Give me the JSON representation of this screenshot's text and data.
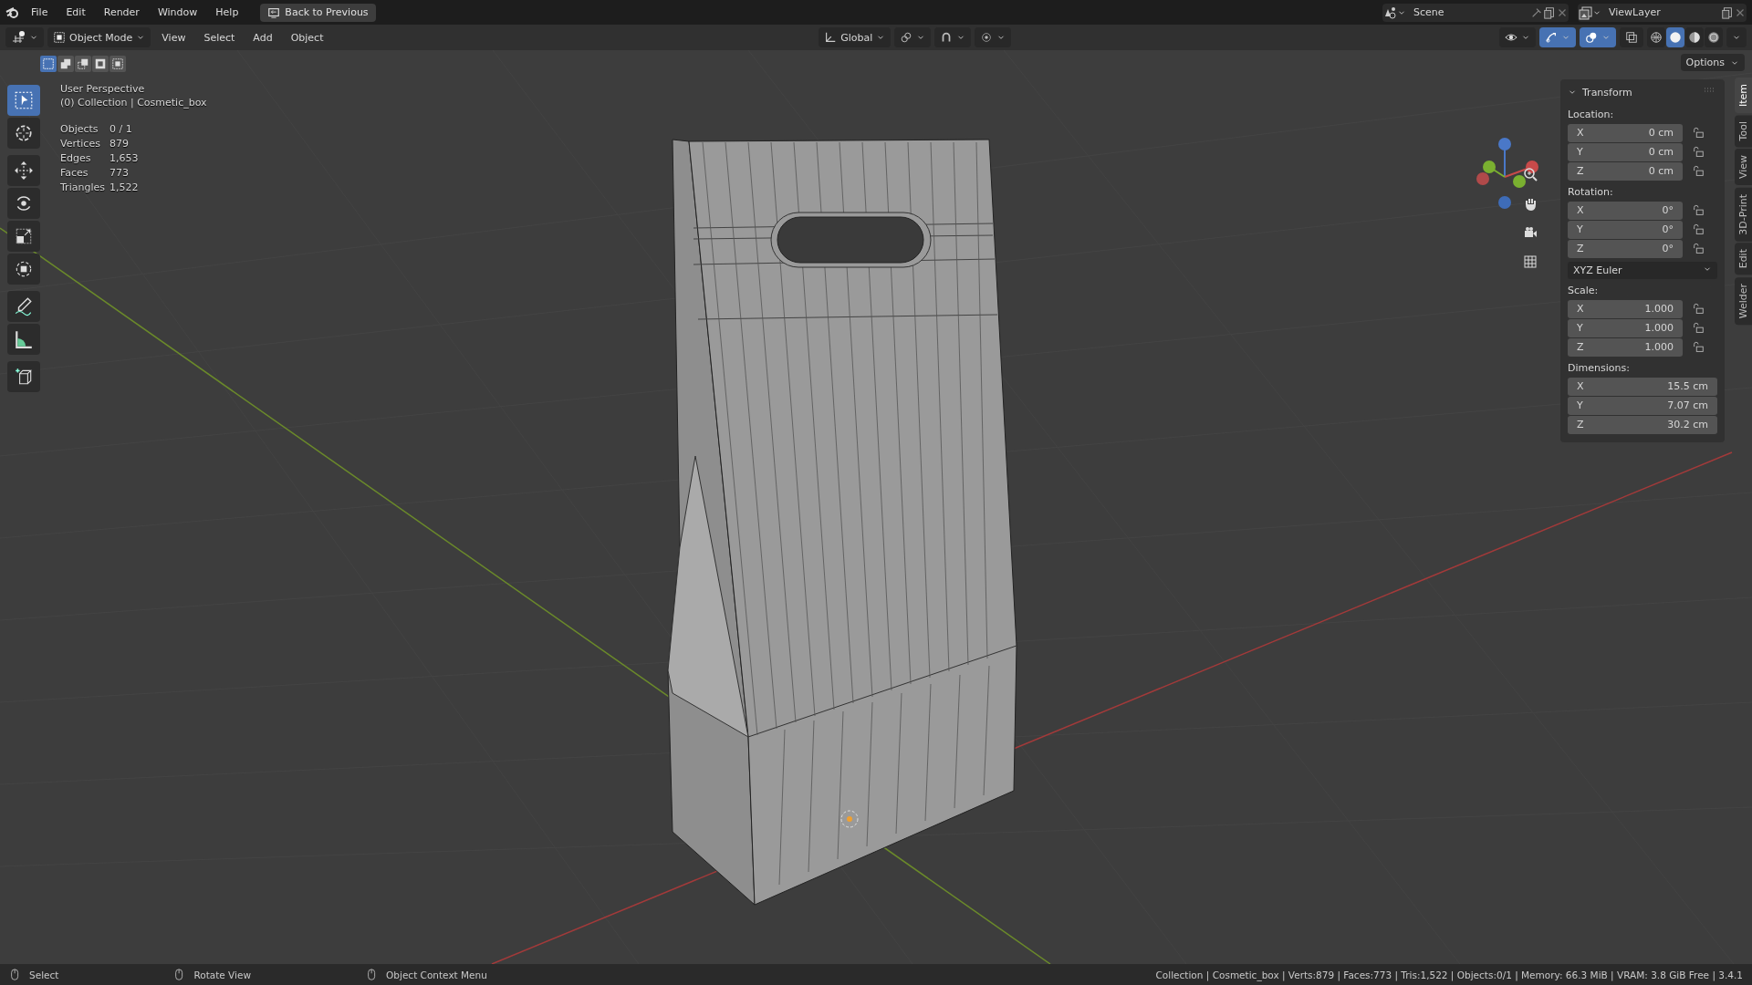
{
  "menubar": {
    "items": [
      "File",
      "Edit",
      "Render",
      "Window",
      "Help"
    ],
    "back_button": "Back to Previous",
    "scene": "Scene",
    "view_layer": "ViewLayer"
  },
  "header": {
    "mode": "Object Mode",
    "menus": [
      "View",
      "Select",
      "Add",
      "Object"
    ],
    "orientation": "Global",
    "toggles": [
      {
        "kind": "pivot",
        "on": false
      },
      {
        "kind": "snap",
        "on": false
      },
      {
        "kind": "proportional",
        "on": false
      },
      {
        "kind": "visibility",
        "on": false
      },
      {
        "kind": "gizmo",
        "on": true
      },
      {
        "kind": "overlay",
        "on": true
      },
      {
        "kind": "xray",
        "on": false
      }
    ],
    "shading": [
      {
        "kind": "wireframe",
        "selected": false
      },
      {
        "kind": "solid",
        "selected": true
      },
      {
        "kind": "material",
        "selected": false
      },
      {
        "kind": "rendered",
        "selected": false
      }
    ],
    "options": "Options"
  },
  "select_modes": [
    {
      "kind": "set",
      "selected": true
    },
    {
      "kind": "extend",
      "selected": false
    },
    {
      "kind": "subtract",
      "selected": false
    },
    {
      "kind": "invert",
      "selected": false
    },
    {
      "kind": "intersect",
      "selected": false
    }
  ],
  "tools": [
    {
      "kind": "select",
      "selected": true
    },
    {
      "kind": "cursor",
      "selected": false
    },
    {
      "kind": "move",
      "selected": false
    },
    {
      "kind": "rotate",
      "selected": false
    },
    {
      "kind": "scale",
      "selected": false
    },
    {
      "kind": "transform",
      "selected": false
    },
    {
      "kind": "annotate",
      "selected": false
    },
    {
      "kind": "measure",
      "selected": false
    },
    {
      "kind": "add-cube",
      "selected": false
    }
  ],
  "viewport": {
    "perspective": "User Perspective",
    "collection": "(0) Collection | Cosmetic_box",
    "stats": [
      {
        "label": "Objects",
        "value": "0 / 1"
      },
      {
        "label": "Vertices",
        "value": "879"
      },
      {
        "label": "Edges",
        "value": "1,653"
      },
      {
        "label": "Faces",
        "value": "773"
      },
      {
        "label": "Triangles",
        "value": "1,522"
      }
    ]
  },
  "transform": {
    "title": "Transform",
    "sections": [
      {
        "label": "Location:",
        "rows": [
          {
            "axis": "X",
            "value": "0 cm",
            "locked": false
          },
          {
            "axis": "Y",
            "value": "0 cm",
            "locked": false
          },
          {
            "axis": "Z",
            "value": "0 cm",
            "locked": false
          }
        ]
      },
      {
        "label": "Rotation:",
        "rows": [
          {
            "axis": "X",
            "value": "0°",
            "locked": false
          },
          {
            "axis": "Y",
            "value": "0°",
            "locked": false
          },
          {
            "axis": "Z",
            "value": "0°",
            "locked": false
          }
        ],
        "mode": "XYZ Euler"
      },
      {
        "label": "Scale:",
        "rows": [
          {
            "axis": "X",
            "value": "1.000",
            "locked": false
          },
          {
            "axis": "Y",
            "value": "1.000",
            "locked": false
          },
          {
            "axis": "Z",
            "value": "1.000",
            "locked": false
          }
        ]
      },
      {
        "label": "Dimensions:",
        "rows": [
          {
            "axis": "X",
            "value": "15.5 cm"
          },
          {
            "axis": "Y",
            "value": "7.07 cm"
          },
          {
            "axis": "Z",
            "value": "30.2 cm"
          }
        ]
      }
    ]
  },
  "side_tabs": [
    {
      "label": "Item",
      "selected": true
    },
    {
      "label": "Tool",
      "selected": false
    },
    {
      "label": "View",
      "selected": false
    },
    {
      "label": "3D-Print",
      "selected": false
    },
    {
      "label": "Edit",
      "selected": false
    },
    {
      "label": "Welder",
      "selected": false
    }
  ],
  "status_bar": {
    "hints": [
      {
        "label": "Select"
      },
      {
        "label": "Rotate View"
      },
      {
        "label": "Object Context Menu"
      }
    ],
    "info": "Collection | Cosmetic_box | Verts:879 | Faces:773 | Tris:1,522 | Objects:0/1 | Memory: 66.3 MiB | VRAM: 3.8 GiB Free | 3.4.1"
  }
}
